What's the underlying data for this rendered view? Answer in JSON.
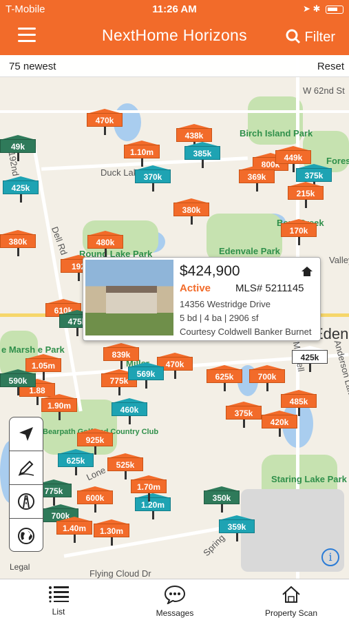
{
  "status_bar": {
    "carrier": "T-Mobile",
    "time": "11:26 AM"
  },
  "header": {
    "title": "NextHome Horizons",
    "filter_label": "Filter"
  },
  "subheader": {
    "count_label": "75 newest",
    "reset_label": "Reset"
  },
  "map": {
    "street_labels": [
      "W 62nd St",
      "Duck Lake Tr",
      "Dell Rd",
      "Valley",
      "Anderson Lakes",
      "Spring",
      "Flying Cloud Dr",
      "Mitchell",
      "Lone",
      "192nd"
    ],
    "place_labels": [
      "Birch Island Park",
      "Round Lake Park",
      "Edenvale Park",
      "Staring Lake Park",
      "Bent Creek",
      "Forest",
      "e Marsh e Park",
      "Miller",
      "Bearpath Golf and Country Club",
      "Eden Pr"
    ],
    "pins": [
      {
        "label": "470k",
        "color": "orange"
      },
      {
        "label": "438k",
        "color": "orange"
      },
      {
        "label": "1.10m",
        "color": "orange"
      },
      {
        "label": "385k",
        "color": "teal"
      },
      {
        "label": "370k",
        "color": "teal"
      },
      {
        "label": "425k",
        "color": "teal"
      },
      {
        "label": "800k",
        "color": "orange"
      },
      {
        "label": "449k",
        "color": "orange"
      },
      {
        "label": "369k",
        "color": "orange"
      },
      {
        "label": "375k",
        "color": "teal"
      },
      {
        "label": "215k",
        "color": "orange"
      },
      {
        "label": "380k",
        "color": "orange"
      },
      {
        "label": "380k",
        "color": "orange"
      },
      {
        "label": "480k",
        "color": "orange"
      },
      {
        "label": "170k",
        "color": "orange"
      },
      {
        "label": "192",
        "color": "orange"
      },
      {
        "label": "610k",
        "color": "orange"
      },
      {
        "label": "475k",
        "color": "green"
      },
      {
        "label": "839k",
        "color": "orange"
      },
      {
        "label": "470k",
        "color": "orange"
      },
      {
        "label": "625k",
        "color": "orange"
      },
      {
        "label": "700k",
        "color": "orange"
      },
      {
        "label": "425k",
        "color": "white"
      },
      {
        "label": "1.05m",
        "color": "orange"
      },
      {
        "label": "1.88",
        "color": "orange"
      },
      {
        "label": "1.90m",
        "color": "orange"
      },
      {
        "label": "775k",
        "color": "orange"
      },
      {
        "label": "569k",
        "color": "teal"
      },
      {
        "label": "460k",
        "color": "teal"
      },
      {
        "label": "375k",
        "color": "orange"
      },
      {
        "label": "485k",
        "color": "orange"
      },
      {
        "label": "420k",
        "color": "orange"
      },
      {
        "label": "925k",
        "color": "orange"
      },
      {
        "label": "625k",
        "color": "teal"
      },
      {
        "label": "525k",
        "color": "orange"
      },
      {
        "label": "600k",
        "color": "orange"
      },
      {
        "label": "1.20m",
        "color": "teal"
      },
      {
        "label": "350k",
        "color": "green"
      },
      {
        "label": "700k",
        "color": "green"
      },
      {
        "label": "1.40m",
        "color": "orange"
      },
      {
        "label": "1.30m",
        "color": "orange"
      },
      {
        "label": "359k",
        "color": "teal"
      },
      {
        "label": "380k",
        "color": "orange"
      },
      {
        "label": "590k",
        "color": "green"
      },
      {
        "label": "49k",
        "color": "green"
      },
      {
        "label": "775k",
        "color": "green"
      },
      {
        "label": "1.70m",
        "color": "orange"
      }
    ],
    "popup": {
      "price": "$424,900",
      "status": "Active",
      "mls": "MLS# 5211145",
      "address": "14356 Westridge Drive",
      "specs": "5 bd | 4 ba | 2906 sf",
      "courtesy": "Courtesy Coldwell Banker Burnet"
    },
    "legal_label": "Legal"
  },
  "tabs": [
    {
      "label": "List",
      "icon": "list-icon"
    },
    {
      "label": "Messages",
      "icon": "chat-bubble-icon"
    },
    {
      "label": "Property Scan",
      "icon": "house-scan-icon"
    }
  ],
  "colors": {
    "brand": "#f26b2a",
    "teal": "#1ea3b3",
    "green": "#2f7a5a"
  }
}
